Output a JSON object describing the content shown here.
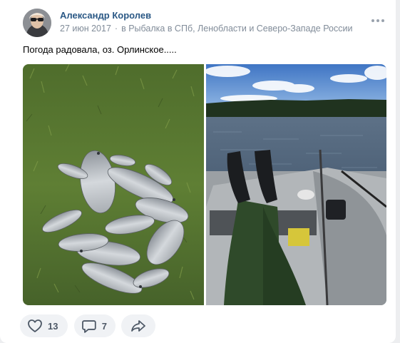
{
  "post": {
    "author": "Александр Королев",
    "date": "27 июн 2017",
    "separator": "·",
    "community": "в Рыбалка в СПб, Ленобласти и Северо-Западе России",
    "text": "Погода радовала, оз. Орлинское....."
  },
  "actions": {
    "likes": "13",
    "comments": "7"
  },
  "icons": {
    "more": "more-horizontal-icon",
    "like": "heart-icon",
    "comment": "comment-icon",
    "share": "share-icon"
  },
  "colors": {
    "link": "#2a5885",
    "muted": "#818c99",
    "button_bg": "#f0f2f5",
    "icon": "#4d5866"
  }
}
